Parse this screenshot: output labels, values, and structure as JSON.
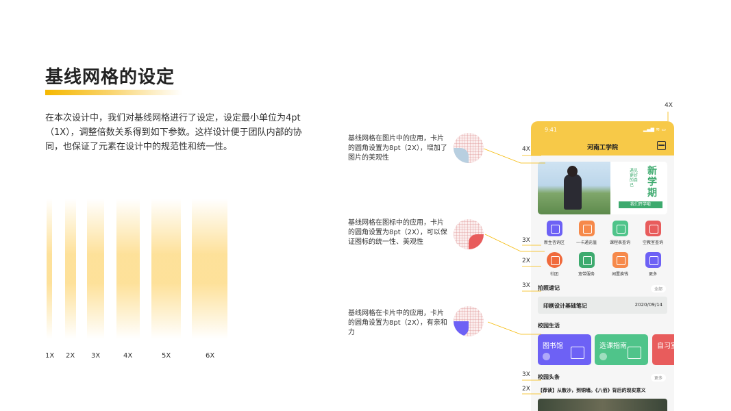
{
  "title": "基线网格的设定",
  "description": "在本次设计中，我们对基线网格进行了设定，设定最小单位为4pt（1X），调整倍数关系得到如下参数。这样设计便于团队内部的协同，也保证了元素在设计中的规范性和统一性。",
  "bars": [
    "1X",
    "2X",
    "3X",
    "4X",
    "5X",
    "6X"
  ],
  "annotations": [
    {
      "text": "基线网格在图片中的应用，卡片的圆角设置为8pt（2X），增加了图片的美观性"
    },
    {
      "text": "基线网格在图标中的应用，卡片的圆角设置为8pt（2X），可以保证图标的统一性、美观性"
    },
    {
      "text": "基线网格在卡片中的应用，卡片的圆角设置为8pt（2X），有亲和力"
    }
  ],
  "markers": {
    "m4x_top": "4X",
    "m4x_left": "4X",
    "m3x_a": "3X",
    "m2x_a": "2X",
    "m3x_b": "3X",
    "m3x_c": "3X",
    "m2x_b": "2X"
  },
  "phone": {
    "time": "9:41",
    "status": "▂▄▆ ≋ ▭",
    "app_title": "河南工学院",
    "banner": {
      "big": "新学期",
      "small": "遇见更好的自己",
      "button": "我们开学啦"
    },
    "grid": [
      {
        "label": "新生咨询区",
        "color": "#6d61f5"
      },
      {
        "label": "一卡通充值",
        "color": "#f6894a"
      },
      {
        "label": "课程表查询",
        "color": "#4fc48a"
      },
      {
        "label": "空教室查询",
        "color": "#e85c5c"
      },
      {
        "label": "社团",
        "color": "#f06a3c"
      },
      {
        "label": "宽带服务",
        "color": "#3daa6e"
      },
      {
        "label": "闲置换钱",
        "color": "#f6894a"
      },
      {
        "label": "更多",
        "color": "#6d61f5"
      }
    ],
    "notes": {
      "title": "拍照速记",
      "more": "全部",
      "item_title": "印刷设计基础笔记",
      "item_date": "2020/09/14"
    },
    "campus": {
      "title": "校园生活",
      "cards": [
        {
          "label": "图书馆",
          "color": "#6d61f5"
        },
        {
          "label": "选课指南",
          "color": "#4fc48a"
        },
        {
          "label": "自习室",
          "color": "#e85c5c"
        }
      ]
    },
    "headlines": {
      "title": "校园头条",
      "more": "更多",
      "item": "【荐读】从散沙，到铜墙。《八佰》背后的现实意义"
    }
  }
}
